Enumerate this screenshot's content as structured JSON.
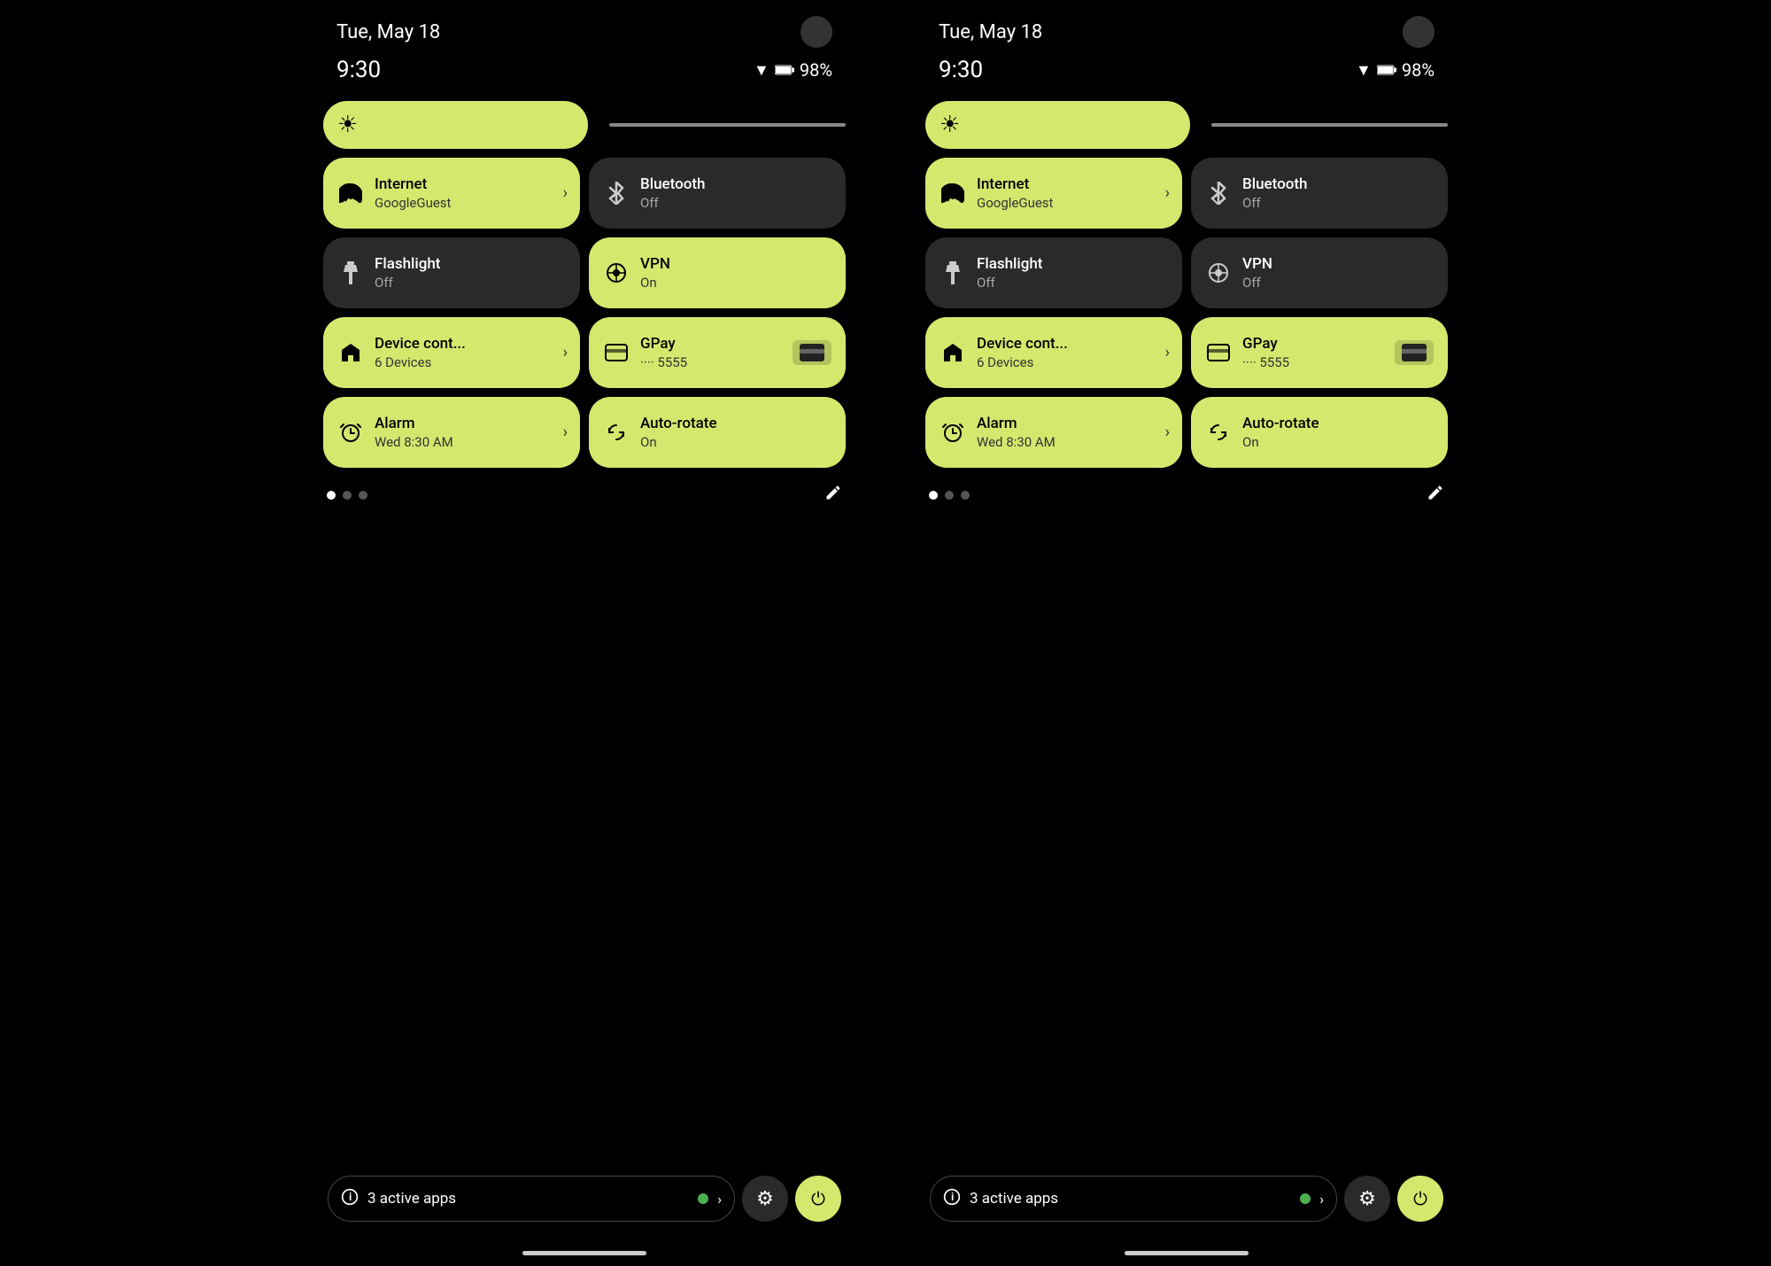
{
  "phones": [
    {
      "id": "phone-left",
      "statusBar": {
        "date": "Tue, May 18",
        "time": "9:30",
        "battery": "98%",
        "wifiIcon": "wifi",
        "batteryIcon": "battery"
      },
      "brightness": {
        "icon": "⚙"
      },
      "tiles": [
        {
          "id": "internet",
          "title": "Internet",
          "subtitle": "GoogleGuest",
          "icon": "wifi",
          "iconSymbol": "▾",
          "active": true,
          "hasArrow": true
        },
        {
          "id": "bluetooth",
          "title": "Bluetooth",
          "subtitle": "Off",
          "icon": "bluetooth",
          "iconSymbol": "✦",
          "active": false,
          "hasArrow": false
        },
        {
          "id": "flashlight",
          "title": "Flashlight",
          "subtitle": "Off",
          "icon": "flashlight",
          "iconSymbol": "🔦",
          "active": false,
          "hasArrow": false
        },
        {
          "id": "vpn",
          "title": "VPN",
          "subtitle": "On",
          "icon": "vpn",
          "iconSymbol": "⊕",
          "active": true,
          "hasArrow": false
        },
        {
          "id": "device-controls",
          "title": "Device cont...",
          "subtitle": "6 Devices",
          "icon": "home",
          "iconSymbol": "⌂",
          "active": true,
          "hasArrow": true
        },
        {
          "id": "gpay",
          "title": "GPay",
          "subtitle": "···· 5555",
          "icon": "card",
          "iconSymbol": "▬",
          "active": true,
          "hasArrow": false,
          "hasCard": true
        },
        {
          "id": "alarm",
          "title": "Alarm",
          "subtitle": "Wed 8:30 AM",
          "icon": "alarm",
          "iconSymbol": "⏰",
          "active": true,
          "hasArrow": true
        },
        {
          "id": "autorotate",
          "title": "Auto-rotate",
          "subtitle": "On",
          "icon": "rotate",
          "iconSymbol": "↻",
          "active": true,
          "hasArrow": false
        }
      ],
      "pagination": {
        "dots": [
          true,
          false,
          false
        ],
        "editIcon": "✎"
      },
      "bottomBar": {
        "activeAppsText": "3 active apps",
        "settingsIcon": "⚙",
        "powerIcon": "⏻"
      }
    },
    {
      "id": "phone-right",
      "statusBar": {
        "date": "Tue, May 18",
        "time": "9:30",
        "battery": "98%"
      },
      "brightness": {
        "icon": "⚙"
      },
      "tiles": [
        {
          "id": "internet",
          "title": "Internet",
          "subtitle": "GoogleGuest",
          "icon": "wifi",
          "iconSymbol": "▾",
          "active": true,
          "hasArrow": true
        },
        {
          "id": "bluetooth",
          "title": "Bluetooth",
          "subtitle": "Off",
          "icon": "bluetooth",
          "iconSymbol": "✦",
          "active": false,
          "hasArrow": false
        },
        {
          "id": "flashlight",
          "title": "Flashlight",
          "subtitle": "Off",
          "icon": "flashlight",
          "iconSymbol": "🔦",
          "active": false,
          "hasArrow": false
        },
        {
          "id": "vpn",
          "title": "VPN",
          "subtitle": "Off",
          "icon": "vpn",
          "iconSymbol": "⊕",
          "active": false,
          "hasArrow": false
        },
        {
          "id": "device-controls",
          "title": "Device cont...",
          "subtitle": "6 Devices",
          "icon": "home",
          "iconSymbol": "⌂",
          "active": true,
          "hasArrow": true
        },
        {
          "id": "gpay",
          "title": "GPay",
          "subtitle": "···· 5555",
          "icon": "card",
          "iconSymbol": "▬",
          "active": true,
          "hasArrow": false,
          "hasCard": true
        },
        {
          "id": "alarm",
          "title": "Alarm",
          "subtitle": "Wed 8:30 AM",
          "icon": "alarm",
          "iconSymbol": "⏰",
          "active": true,
          "hasArrow": true
        },
        {
          "id": "autorotate",
          "title": "Auto-rotate",
          "subtitle": "On",
          "icon": "rotate",
          "iconSymbol": "↻",
          "active": true,
          "hasArrow": false
        }
      ],
      "pagination": {
        "dots": [
          true,
          false,
          false
        ],
        "editIcon": "✎"
      },
      "bottomBar": {
        "activeAppsText": "3 active apps",
        "settingsIcon": "⚙",
        "powerIcon": "⏻"
      }
    }
  ],
  "colors": {
    "activeTile": "#d4e86e",
    "inactiveTile": "#2a2a2a",
    "background": "#000000",
    "activeText": "#000000",
    "inactiveText": "#ffffff"
  }
}
